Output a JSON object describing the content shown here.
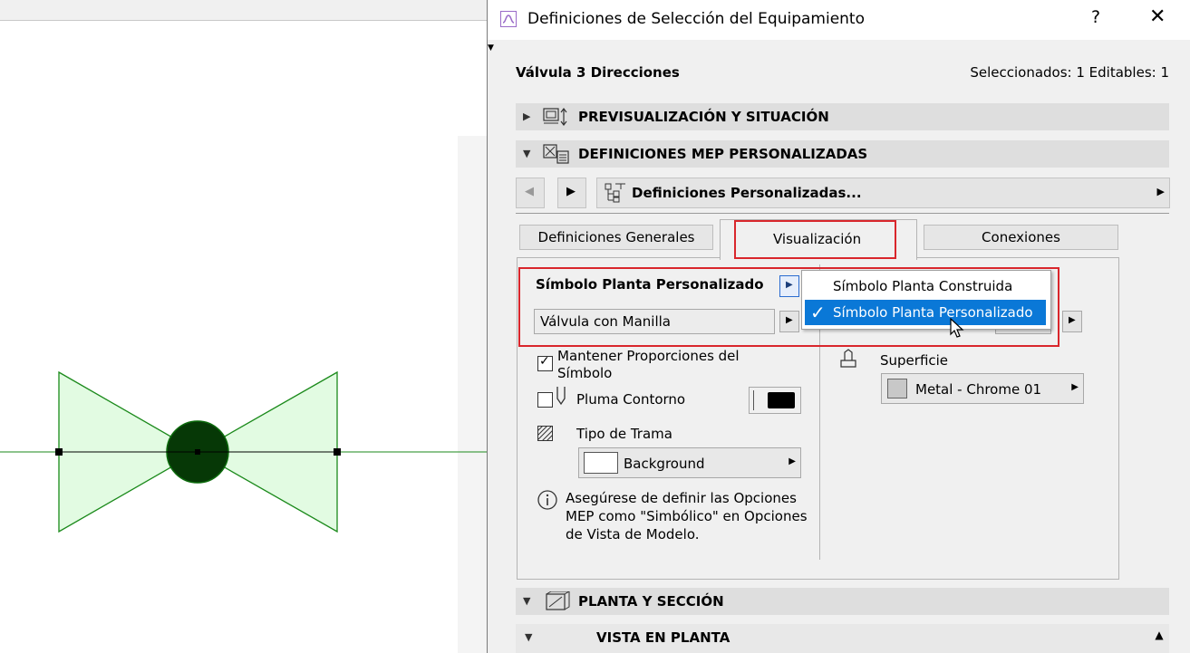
{
  "window": {
    "title": "Definiciones de Selección del Equipamiento",
    "help": "?",
    "close": "✕"
  },
  "header": {
    "object_name": "Válvula 3 Direcciones",
    "selection_info": "Seleccionados: 1 Editables: 1"
  },
  "sections": {
    "preview": "PREVISUALIZACIÓN Y SITUACIÓN",
    "mep": "DEFINICIONES MEP PERSONALIZADAS",
    "plan": "PLANTA Y SECCIÓN",
    "plan_view": "VISTA EN PLANTA"
  },
  "nav": {
    "dropdown": "Definiciones Personalizadas..."
  },
  "tabs": {
    "general": "Definiciones Generales",
    "display": "Visualización",
    "connections": "Conexiones"
  },
  "panel": {
    "symbol_label": "Símbolo Planta Personalizado",
    "symbol_value": "Válvula con Manilla",
    "keep_proportions": "Mantener Proporciones del Símbolo",
    "keep_proportions_checked": true,
    "contour_pen": "Pluma Contorno",
    "contour_pen_checked": false,
    "pen_color": "#000000",
    "hatch_type": "Tipo de Trama",
    "hatch_value": "Background",
    "info_text": "Asegúrese de definir las Opciones MEP como \"Simbólico\" en Opciones de Vista de Modelo.",
    "surface_label": "Superficie",
    "surface_value": "Metal - Chrome 01",
    "surface_swatch": "#c8c8c8"
  },
  "menu": {
    "option1": "Símbolo Planta Construida",
    "option2": "Símbolo Planta Personalizado",
    "selected": "Símbolo Planta Personalizado"
  },
  "colors": {
    "highlight_red": "#d9262c",
    "selection_blue": "#0a78d7",
    "valve_fill": "#e2fbe2",
    "valve_stroke": "#1b8a1b",
    "valve_center": "#063806"
  }
}
